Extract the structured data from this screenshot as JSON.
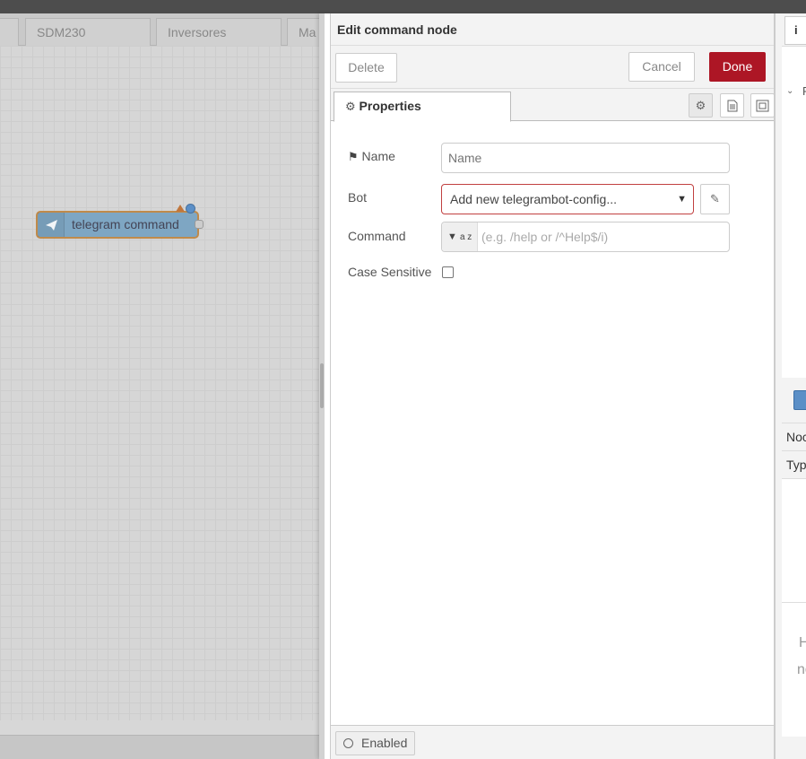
{
  "workspace": {
    "tabs": [
      "",
      "SDM230",
      "Inversores",
      "Ma"
    ],
    "node": {
      "label": "telegram command",
      "icon": "paper-plane-icon"
    }
  },
  "tray": {
    "title": "Edit command node",
    "delete_label": "Delete",
    "cancel_label": "Cancel",
    "done_label": "Done",
    "done_color": "#ad1625",
    "properties_tab": "Properties",
    "tab_buttons": [
      "gear-icon",
      "document-icon",
      "appearance-icon"
    ],
    "fields": {
      "name": {
        "label": "Name",
        "placeholder": "Name",
        "icon": "tag-icon"
      },
      "bot": {
        "label": "Bot",
        "value": "Add new telegrambot-config..."
      },
      "command": {
        "label": "Command",
        "type_label": "a z",
        "placeholder": "(e.g. /help or /^Help$/i)"
      },
      "case_sensitive": {
        "label": "Case Sensitive",
        "checked": false
      }
    },
    "footer": {
      "enabled_label": "Enabled"
    }
  },
  "sidebar": {
    "tab_icon": "info-icon",
    "tab_glyph": "i",
    "row1": "Noc",
    "row2": "Typ",
    "help_fragment_1": "H",
    "help_fragment_2": "no"
  }
}
